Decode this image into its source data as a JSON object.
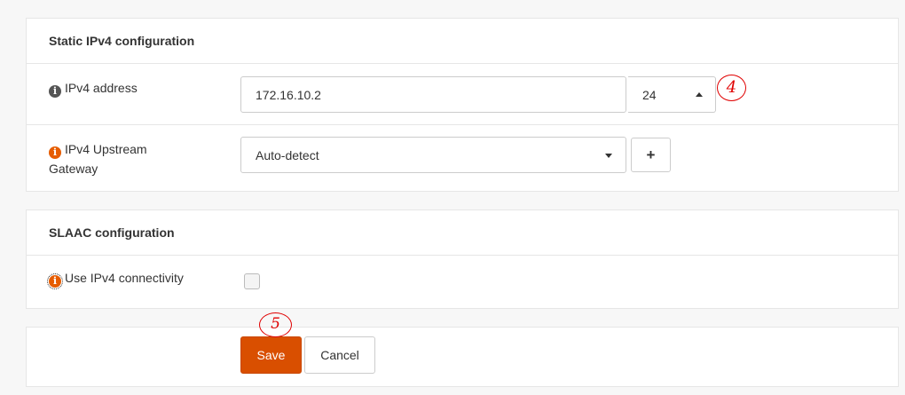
{
  "static_ipv4": {
    "title": "Static IPv4 configuration",
    "address_label": "IPv4 address",
    "address_value": "172.16.10.2",
    "prefix_value": "24",
    "gateway_label_line1": "IPv4 Upstream",
    "gateway_label_line2": "Gateway",
    "gateway_value": "Auto-detect",
    "add_label": "+"
  },
  "slaac": {
    "title": "SLAAC configuration",
    "use_ipv4_label": "Use IPv4 connectivity",
    "use_ipv4_checked": false
  },
  "actions": {
    "save_label": "Save",
    "cancel_label": "Cancel"
  },
  "annotations": {
    "step4": "4",
    "step5": "5"
  },
  "colors": {
    "primary": "#d94f00",
    "annotation": "#e00000"
  }
}
